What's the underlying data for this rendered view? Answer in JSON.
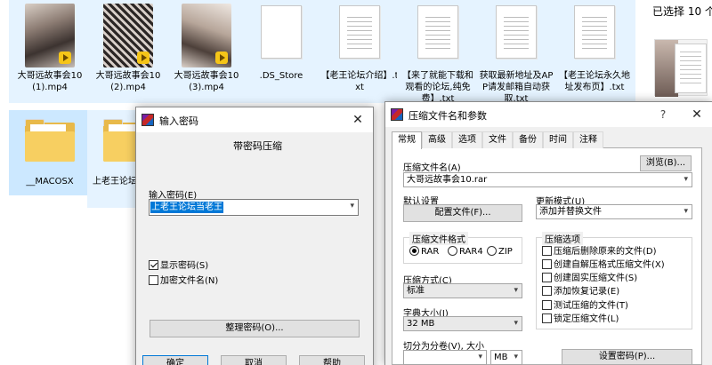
{
  "explorer": {
    "selection_status": "已选择 10 个",
    "files": [
      {
        "name": "大哥远故事会10(1).mp4",
        "type": "video"
      },
      {
        "name": "大哥远故事会10(2).mp4",
        "type": "video"
      },
      {
        "name": "大哥远故事会10(3).mp4",
        "type": "video"
      },
      {
        "name": ".DS_Store",
        "type": "file"
      },
      {
        "name": "【老王论坛介绍】.txt",
        "type": "text"
      },
      {
        "name": "【来了就能下载和观看的论坛,纯免费】.txt",
        "type": "text"
      },
      {
        "name": "获取最新地址及APP请发邮箱自动获取.txt",
        "type": "text"
      },
      {
        "name": "【老王论坛永久地址发布页】.txt",
        "type": "text"
      },
      {
        "name": "__MACOSX",
        "type": "folder"
      },
      {
        "name": "上老王论坛当老王",
        "type": "folder"
      }
    ]
  },
  "password_dialog": {
    "title": "输入密码",
    "subtitle": "带密码压缩",
    "password_label": "输入密码(E)",
    "password_value": "上老王论坛当老王",
    "show_password_label": "显示密码(S)",
    "show_password_checked": true,
    "encrypt_names_label": "加密文件名(N)",
    "encrypt_names_checked": false,
    "organize_button": "整理密码(O)...",
    "ok_button": "确定",
    "cancel_button": "取消",
    "help_button": "帮助"
  },
  "archive_dialog": {
    "title": "压缩文件名和参数",
    "help_glyph": "?",
    "close_glyph": "✕",
    "tabs": [
      "常规",
      "高级",
      "选项",
      "文件",
      "备份",
      "时间",
      "注释"
    ],
    "active_tab": "常规",
    "archive_name_label": "压缩文件名(A)",
    "archive_name_value": "大哥远故事会10.rar",
    "browse_button": "浏览(B)...",
    "default_settings_label": "默认设置",
    "profiles_button": "配置文件(F)...",
    "update_mode_label": "更新模式(U)",
    "update_mode_value": "添加并替换文件",
    "format_group_label": "压缩文件格式",
    "formats": [
      {
        "label": "RAR",
        "checked": true
      },
      {
        "label": "RAR4",
        "checked": false
      },
      {
        "label": "ZIP",
        "checked": false
      }
    ],
    "method_label": "压缩方式(C)",
    "method_value": "标准",
    "dict_size_label": "字典大小(I)",
    "dict_size_value": "32 MB",
    "split_label": "切分为分卷(V), 大小",
    "split_value": "",
    "split_unit": "MB",
    "options_group_label": "压缩选项",
    "options": [
      {
        "label": "压缩后删除原来的文件(D)",
        "checked": false
      },
      {
        "label": "创建自解压格式压缩文件(X)",
        "checked": false
      },
      {
        "label": "创建固实压缩文件(S)",
        "checked": false
      },
      {
        "label": "添加恢复记录(E)",
        "checked": false
      },
      {
        "label": "测试压缩的文件(T)",
        "checked": false
      },
      {
        "label": "锁定压缩文件(L)",
        "checked": false
      }
    ],
    "set_password_button": "设置密码(P)..."
  },
  "icons": {
    "dropdown": "▾",
    "close": "✕"
  }
}
